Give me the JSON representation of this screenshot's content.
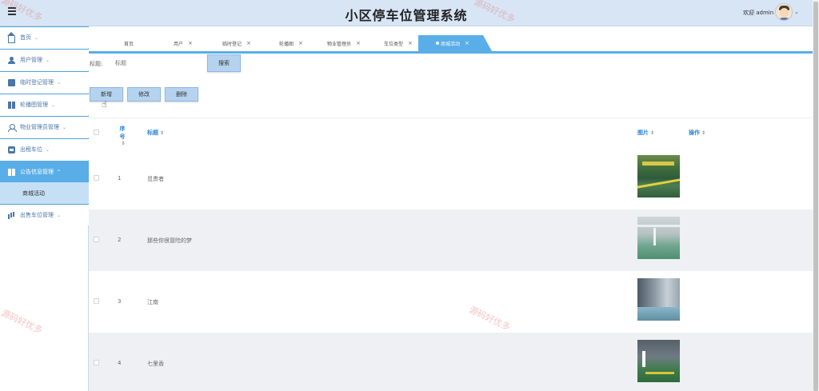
{
  "header": {
    "title": "小区停车位管理系统",
    "welcome": "欢迎 admin",
    "user_caret": "⌄"
  },
  "sidebar": {
    "items": [
      {
        "label": "首页",
        "icon": "home-icon"
      },
      {
        "label": "用户管理",
        "icon": "user-icon"
      },
      {
        "label": "临时登记管理",
        "icon": "calendar-icon"
      },
      {
        "label": "轮播图管理",
        "icon": "book-icon"
      },
      {
        "label": "物业管理员管理",
        "icon": "person-icon"
      },
      {
        "label": "出租车位",
        "icon": "car-icon"
      },
      {
        "label": "公告信息管理",
        "icon": "gift-icon"
      },
      {
        "label": "出售车位管理",
        "icon": "bars-icon"
      }
    ],
    "sub_active": "商城活动",
    "chevron_down": "⌄",
    "chevron_up": "^"
  },
  "tabs": [
    {
      "label": "首页"
    },
    {
      "label": "用户"
    },
    {
      "label": "临时登记"
    },
    {
      "label": "轮播图"
    },
    {
      "label": "物业管理员"
    },
    {
      "label": "车位类型"
    },
    {
      "label": "商城活动"
    }
  ],
  "tab_close": "×",
  "search": {
    "label": "标题:",
    "placeholder": "标题",
    "button": "搜索"
  },
  "actions": {
    "add": "新增",
    "edit": "修改",
    "delete": "删除"
  },
  "table": {
    "columns": {
      "index": "序号",
      "title": "标题",
      "image": "图片",
      "action": "操作"
    },
    "sort_glyph": "⇕",
    "rows": [
      {
        "index": "1",
        "title": "觅贵者"
      },
      {
        "index": "2",
        "title": "那些你很冒险的梦"
      },
      {
        "index": "3",
        "title": "江南"
      },
      {
        "index": "4",
        "title": "七里香"
      }
    ]
  },
  "watermark": "源码好优多",
  "colors": {
    "accent": "#59aee8",
    "header_bg": "#d7e5f5",
    "button_bg": "#b5d3ef",
    "link_blue": "#2f86d6"
  }
}
